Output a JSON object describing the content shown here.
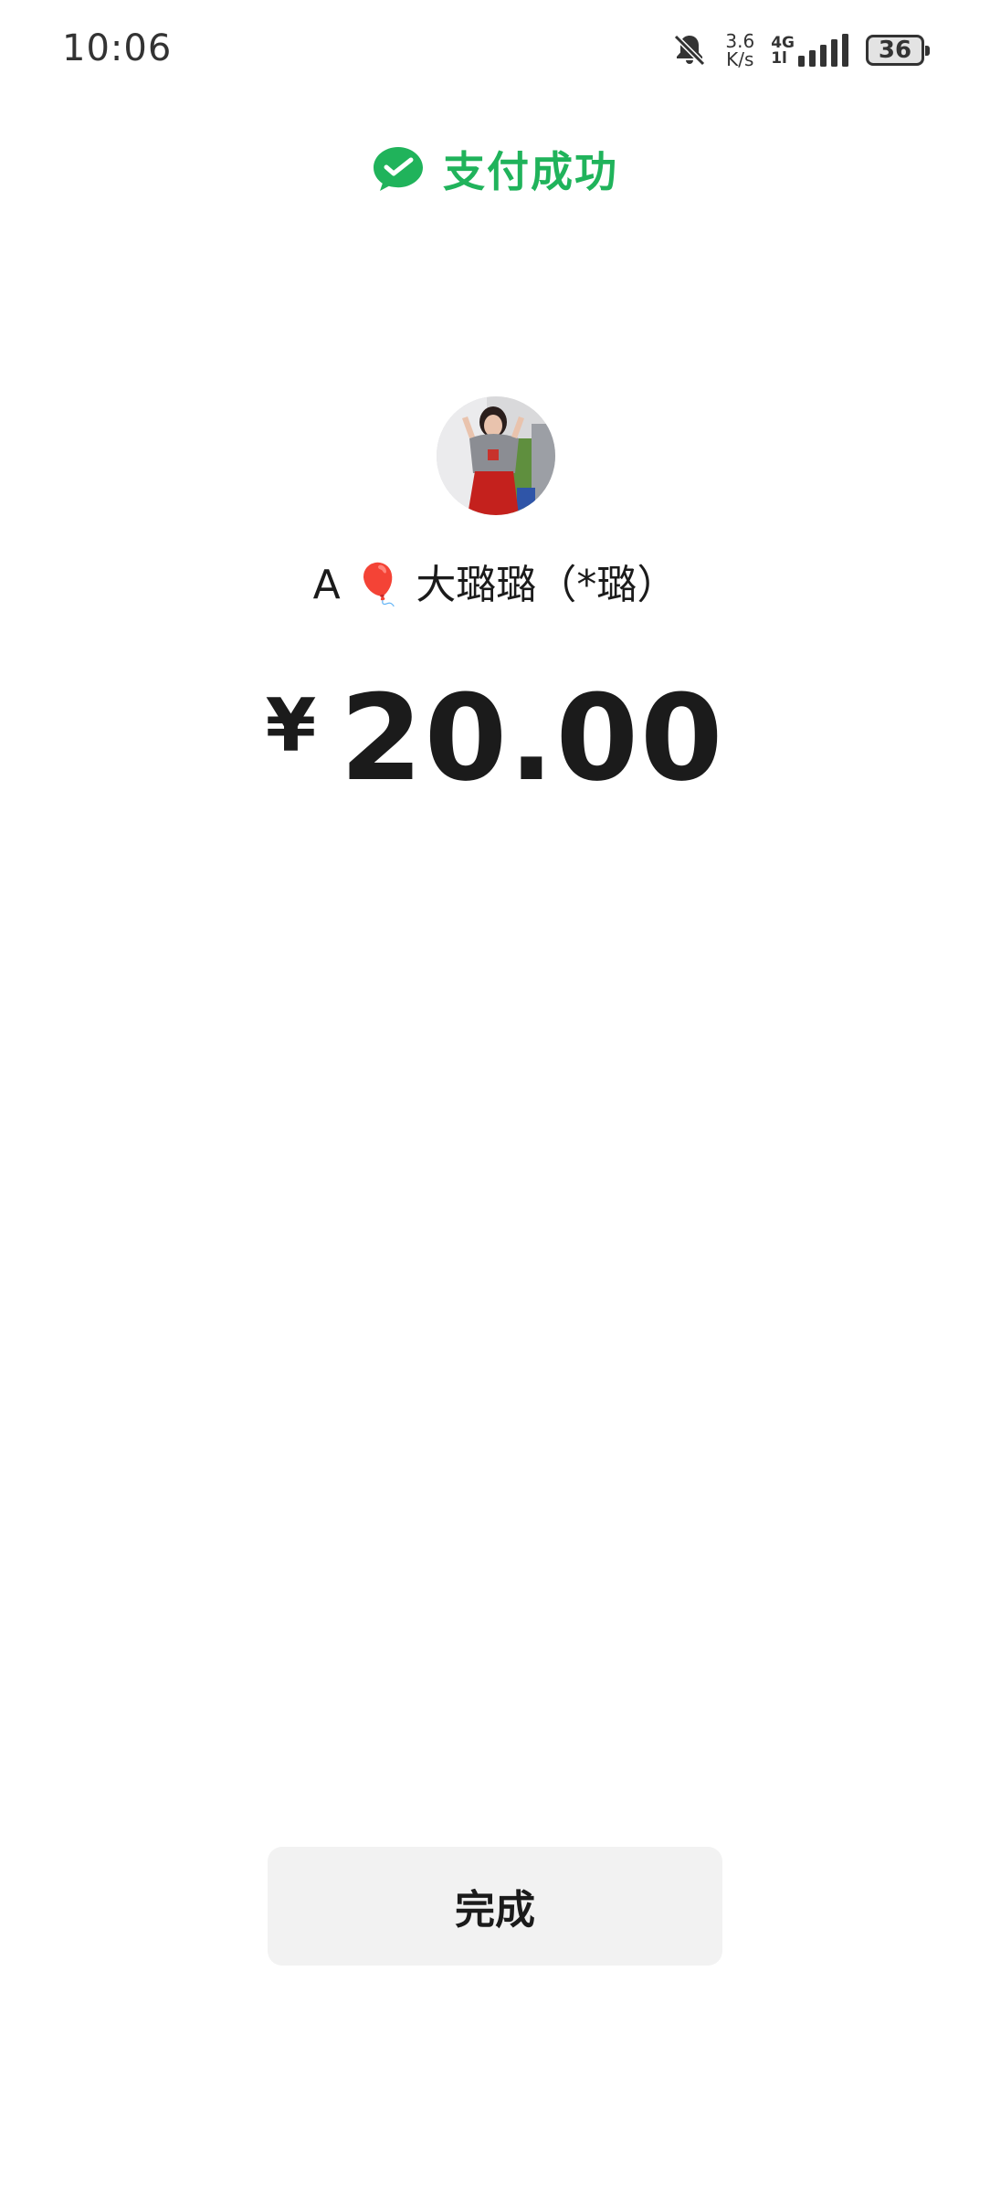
{
  "status_bar": {
    "time": "10:06",
    "net_speed_value": "3.6",
    "net_speed_unit": "K/s",
    "network_type": "4G",
    "network_sub": "1l",
    "battery": "36"
  },
  "header": {
    "title": "支付成功",
    "brand_color": "#20b35b",
    "icon": "wechat-pay-icon"
  },
  "payee": {
    "name": "A 🎈 大璐璐（*璐）",
    "avatar": "avatar-photo"
  },
  "payment": {
    "currency_symbol": "¥",
    "amount": "20.00"
  },
  "actions": {
    "done_label": "完成"
  }
}
